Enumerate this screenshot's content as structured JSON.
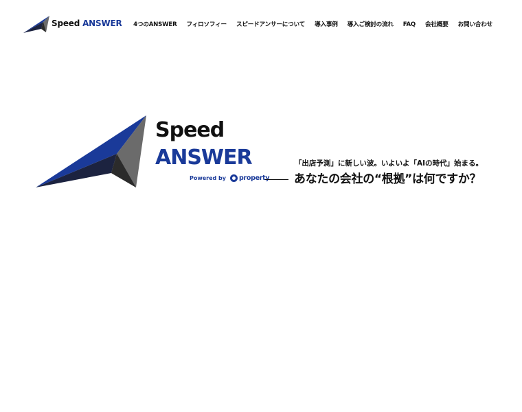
{
  "header": {
    "logo": {
      "word1": "Speed",
      "word2": "ANSWER"
    },
    "nav": [
      "4つのANSWER",
      "フィロソフィー",
      "スピードアンサーについて",
      "導入事例",
      "導入ご検討の流れ",
      "FAQ",
      "会社概要",
      "お問い合わせ"
    ]
  },
  "hero": {
    "logo_word1": "Speed",
    "logo_word2": "ANSWER",
    "powered_by": "Powered by",
    "partner": "property",
    "tagline_sub": "「出店予測」に新しい波。いよいよ「AIの時代」始まる。",
    "tagline_main": "あなたの会社の“根拠”は何ですか？"
  },
  "colors": {
    "brand_navy": "#1a3a99",
    "brand_dark": "#1c2340",
    "brand_gray": "#6b6b6b",
    "text": "#111111",
    "background": "#ffffff"
  },
  "icons": {
    "logo_mark": "paper-plane-mark-icon",
    "partner_mark": "property-logo-icon"
  }
}
